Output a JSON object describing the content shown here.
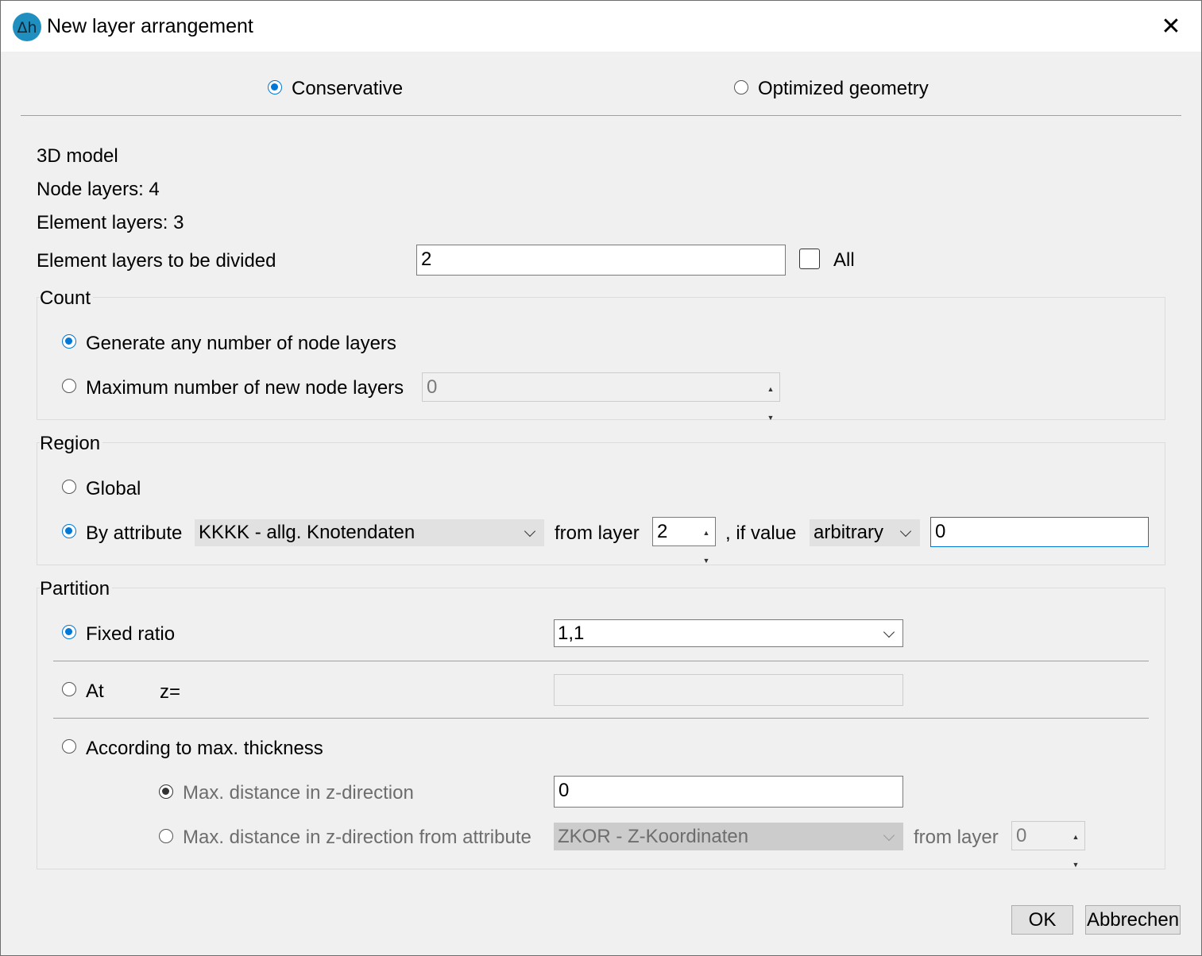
{
  "window": {
    "title": "New layer arrangement",
    "close_glyph": "✕"
  },
  "mode": {
    "conservative": "Conservative",
    "optimized": "Optimized geometry"
  },
  "info": {
    "model": "3D model",
    "node_layers": "Node layers: 4",
    "element_layers": "Element layers: 3",
    "divide_label": "Element layers to be divided",
    "divide_value": "2",
    "all_label": "All"
  },
  "count": {
    "title": "Count",
    "any": "Generate any number of node layers",
    "max": "Maximum number of new node layers",
    "max_value": "0"
  },
  "region": {
    "title": "Region",
    "global": "Global",
    "by_attribute": "By attribute",
    "attribute_value": "KKKK - allg. Knotendaten",
    "from_layer": "from layer",
    "from_layer_value": "2",
    "if_value": ", if value",
    "condition_value": "arbitrary",
    "value": "0"
  },
  "partition": {
    "title": "Partition",
    "fixed_ratio": "Fixed ratio",
    "ratio_value": "1,1",
    "at": "At",
    "z_label": "z=",
    "z_value": "",
    "max_thickness": "According to max. thickness",
    "max_distance": "Max. distance in z-direction",
    "max_distance_value": "0",
    "max_distance_attr": "Max. distance in z-direction from attribute",
    "attr_value": "ZKOR - Z-Koordinaten",
    "from_layer": "from layer",
    "from_layer_value": "0"
  },
  "buttons": {
    "ok": "OK",
    "cancel": "Abbrechen"
  },
  "colors": {
    "accent": "#0078d7",
    "icon": "#1f8fbf"
  }
}
